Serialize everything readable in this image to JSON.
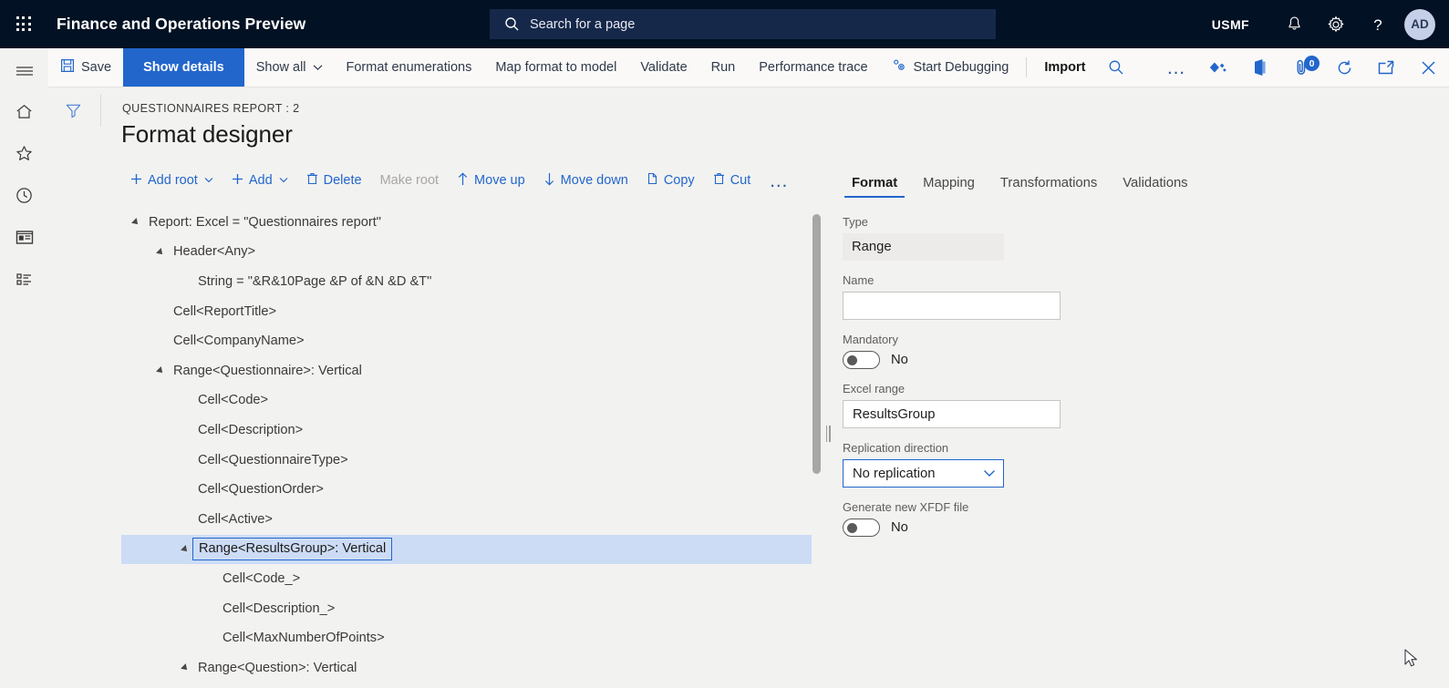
{
  "topbar": {
    "waffle_label": "App launcher",
    "app_title": "Finance and Operations Preview",
    "search_placeholder": "Search for a page",
    "company": "USMF",
    "avatar_initials": "AD",
    "icons": [
      "notifications-bell-icon",
      "settings-gear-icon",
      "help-question-icon"
    ]
  },
  "rail": {
    "items": [
      {
        "name": "hamburger-menu",
        "label": "Expand the navigation pane"
      },
      {
        "name": "home",
        "label": "Home"
      },
      {
        "name": "favorites-star",
        "label": "Favorites"
      },
      {
        "name": "recent-clock",
        "label": "Recent"
      },
      {
        "name": "workspaces",
        "label": "Workspaces"
      },
      {
        "name": "modules-list",
        "label": "Modules"
      }
    ]
  },
  "commandbar": {
    "save": "Save",
    "show_details": "Show details",
    "show_all": "Show all",
    "format_enumerations": "Format enumerations",
    "map_format_to_model": "Map format to model",
    "validate": "Validate",
    "run": "Run",
    "performance_trace": "Performance trace",
    "start_debugging": "Start Debugging",
    "import": "Import",
    "search_icon": "search-icon",
    "overflow": "…",
    "attachments_badge": "0",
    "right_icons": [
      "share-diamond-icon",
      "office-app-icon",
      "attachments-icon",
      "refresh-icon",
      "open-in-new-window-icon",
      "close-icon"
    ],
    "active_accent": "#2266cc"
  },
  "page": {
    "filter_icon": "filter-funnel-icon",
    "breadcrumb": "QUESTIONNAIRES REPORT : 2",
    "title": "Format designer"
  },
  "tree_toolbar": {
    "items": [
      {
        "label": "Add root",
        "icon": "plus-icon",
        "caret": true,
        "disabled": false
      },
      {
        "label": "Add",
        "icon": "plus-icon",
        "caret": true,
        "disabled": false
      },
      {
        "label": "Delete",
        "icon": "trash-icon",
        "caret": false,
        "disabled": false
      },
      {
        "label": "Make root",
        "icon": "",
        "caret": false,
        "disabled": true
      },
      {
        "label": "Move up",
        "icon": "arrow-up-icon",
        "caret": false,
        "disabled": false
      },
      {
        "label": "Move down",
        "icon": "arrow-down-icon",
        "caret": false,
        "disabled": false
      },
      {
        "label": "Copy",
        "icon": "copy-icon",
        "caret": false,
        "disabled": false
      },
      {
        "label": "Cut",
        "icon": "trash-icon",
        "caret": false,
        "disabled": false
      },
      {
        "label": "…",
        "icon": "",
        "caret": false,
        "disabled": false
      }
    ]
  },
  "tree": {
    "nodes": [
      {
        "label": "Report: Excel = \"Questionnaires report\"",
        "depth": 0,
        "expandable": true,
        "selected": false
      },
      {
        "label": "Header<Any>",
        "depth": 1,
        "expandable": true,
        "selected": false
      },
      {
        "label": "String = \"&R&10Page &P of &N &D &T\"",
        "depth": 2,
        "expandable": false,
        "selected": false
      },
      {
        "label": "Cell<ReportTitle>",
        "depth": 1,
        "expandable": false,
        "selected": false
      },
      {
        "label": "Cell<CompanyName>",
        "depth": 1,
        "expandable": false,
        "selected": false
      },
      {
        "label": "Range<Questionnaire>: Vertical",
        "depth": 1,
        "expandable": true,
        "selected": false
      },
      {
        "label": "Cell<Code>",
        "depth": 2,
        "expandable": false,
        "selected": false
      },
      {
        "label": "Cell<Description>",
        "depth": 2,
        "expandable": false,
        "selected": false
      },
      {
        "label": "Cell<QuestionnaireType>",
        "depth": 2,
        "expandable": false,
        "selected": false
      },
      {
        "label": "Cell<QuestionOrder>",
        "depth": 2,
        "expandable": false,
        "selected": false
      },
      {
        "label": "Cell<Active>",
        "depth": 2,
        "expandable": false,
        "selected": false
      },
      {
        "label": "Range<ResultsGroup>: Vertical",
        "depth": 2,
        "expandable": true,
        "selected": true
      },
      {
        "label": "Cell<Code_>",
        "depth": 3,
        "expandable": false,
        "selected": false
      },
      {
        "label": "Cell<Description_>",
        "depth": 3,
        "expandable": false,
        "selected": false
      },
      {
        "label": "Cell<MaxNumberOfPoints>",
        "depth": 3,
        "expandable": false,
        "selected": false
      },
      {
        "label": "Range<Question>: Vertical",
        "depth": 2,
        "expandable": true,
        "selected": false
      }
    ],
    "selection_color": "#cddcf5"
  },
  "properties": {
    "tabs": [
      {
        "label": "Format",
        "active": true
      },
      {
        "label": "Mapping",
        "active": false
      },
      {
        "label": "Transformations",
        "active": false
      },
      {
        "label": "Validations",
        "active": false
      }
    ],
    "fields": {
      "type_label": "Type",
      "type_value": "Range",
      "name_label": "Name",
      "name_value": "",
      "mandatory_label": "Mandatory",
      "mandatory_value": "No",
      "excel_range_label": "Excel range",
      "excel_range_value": "ResultsGroup",
      "replication_label": "Replication direction",
      "replication_value": "No replication",
      "xfdf_label": "Generate new XFDF file",
      "xfdf_value": "No"
    }
  }
}
